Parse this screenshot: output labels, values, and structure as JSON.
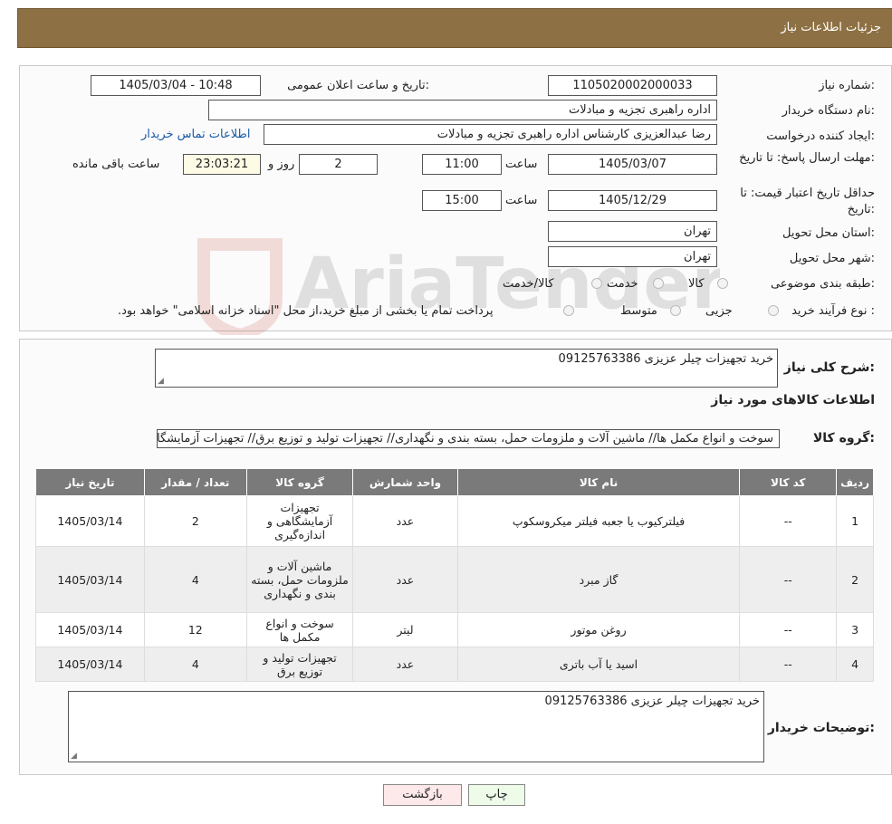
{
  "header": {
    "title": "جزئیات اطلاعات نیاز"
  },
  "form": {
    "need_number_label": "شماره نیاز:",
    "need_number": "1105020002000033",
    "announce_label": "تاریخ و ساعت اعلان عمومی:",
    "announce_value": "1405/03/04 - 10:48",
    "buyer_org_label": "نام دستگاه خریدار:",
    "buyer_org": "اداره راهبری تجزیه و مبادلات",
    "requester_label": "ایجاد کننده درخواست:",
    "requester": "رضا عبدالعزیزی کارشناس اداره راهبری تجزیه و مبادلات",
    "contact_link": "اطلاعات تماس خریدار",
    "deadline_label": "مهلت ارسال پاسخ: تا تاریخ:",
    "deadline_date": "1405/03/07",
    "time_label": "ساعت",
    "deadline_time": "11:00",
    "days_value": "2",
    "days_label": "روز و",
    "remaining_time": "23:03:21",
    "remaining_label": "ساعت باقی مانده",
    "validity_label": "حداقل تاریخ اعتبار قیمت: تا تاریخ:",
    "validity_date": "1405/12/29",
    "validity_time": "15:00",
    "province_label": "استان محل تحویل:",
    "province": "تهران",
    "city_label": "شهر محل تحویل:",
    "city": "تهران",
    "category_label": "طبقه بندی موضوعی:",
    "category_options": [
      "کالا",
      "خدمت",
      "کالا/خدمت"
    ],
    "process_label": "نوع فرآیند خرید :",
    "process_options": [
      "جزیی",
      "متوسط"
    ],
    "process_note": "پرداخت تمام یا بخشی از مبلغ خرید،از محل \"اسناد خزانه اسلامی\" خواهد بود."
  },
  "description": {
    "label": "شرح کلی نیاز:",
    "value": "خرید تجهیزات چیلر عزیزی 09125763386"
  },
  "goods": {
    "section_title": "اطلاعات کالاهای مورد نیاز",
    "group_label": "گروه کالا:",
    "group_value": "سوخت و انواع مکمل ها// ماشین آلات و ملزومات حمل، بسته بندی و نگهداری// تجهیزات تولید و توزیع برق// تجهیزات آزمایشگاهی"
  },
  "table": {
    "headers": [
      "ردیف",
      "کد کالا",
      "نام کالا",
      "واحد شمارش",
      "گروه کالا",
      "تعداد / مقدار",
      "تاریخ نیاز"
    ],
    "rows": [
      [
        "1",
        "--",
        "فیلترکیوب یا جعبه فیلتر میکروسکوپ",
        "عدد",
        "تجهیزات آزمایشگاهی و اندازه‌گیری",
        "2",
        "1405/03/14"
      ],
      [
        "2",
        "--",
        "گاز مبرد",
        "عدد",
        "ماشین آلات و ملزومات حمل، بسته بندی و نگهداری",
        "4",
        "1405/03/14"
      ],
      [
        "3",
        "--",
        "روغن موتور",
        "لیتر",
        "سوخت و انواع مکمل ها",
        "12",
        "1405/03/14"
      ],
      [
        "4",
        "--",
        "اسید یا آب باتری",
        "عدد",
        "تجهیزات تولید و توزیع برق",
        "4",
        "1405/03/14"
      ]
    ]
  },
  "buyer_notes": {
    "label": "توضیحات خریدار:",
    "value": "خرید تجهیزات چیلر عزیزی 09125763386"
  },
  "buttons": {
    "print": "چاپ",
    "back": "بازگشت"
  },
  "watermark": {
    "text": "AriaTender.neT"
  },
  "colors": {
    "header_bg": "#8d7043",
    "table_header_bg": "#7a7a7a",
    "link": "#1a5aa8",
    "back_button_bg": "#fde8ea",
    "print_button_bg": "#eefbe9"
  }
}
